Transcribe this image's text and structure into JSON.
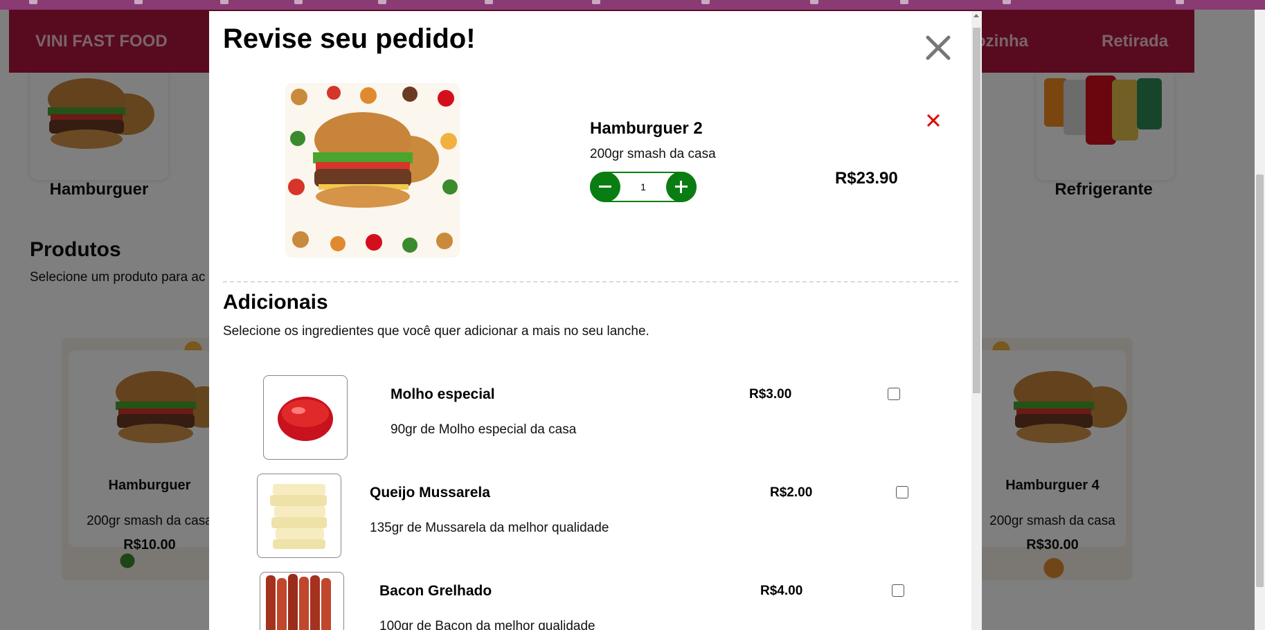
{
  "navbar": {
    "brand": "VINI FAST FOOD",
    "links": [
      "ozinha",
      "Retirada"
    ]
  },
  "categories": [
    {
      "label": "Hamburguer"
    },
    {
      "label": "Refrigerante"
    }
  ],
  "products_section": {
    "title": "Produtos",
    "subtitle": "Selecione um produto para ac"
  },
  "product_cards": [
    {
      "name": "Hamburguer",
      "description": "200gr smash da casa",
      "price": "R$10.00"
    },
    {
      "name": "Hamburguer 4",
      "description": "200gr smash da casa",
      "price": "R$30.00"
    }
  ],
  "modal": {
    "title": "Revise seu pedido!",
    "close_icon": "close-icon",
    "item": {
      "name": "Hamburguer 2",
      "description": "200gr smash da casa",
      "quantity": "1",
      "price": "R$23.90",
      "remove_icon": "remove-icon"
    },
    "additionals": {
      "title": "Adicionais",
      "subtitle": "Selecione os ingredientes que você quer adicionar a mais no seu lanche.",
      "items": [
        {
          "name": "Molho especial",
          "description": "90gr de Molho especial da casa",
          "price": "R$3.00",
          "checked": false
        },
        {
          "name": "Queijo Mussarela",
          "description": "135gr de Mussarela da melhor qualidade",
          "price": "R$2.00",
          "checked": false
        },
        {
          "name": "Bacon Grelhado",
          "description": "100gr de Bacon da melhor qualidade",
          "price": "R$4.00",
          "checked": false
        }
      ]
    }
  },
  "colors": {
    "navbar": "#b1163f",
    "navbar_text": "#f4c7d3",
    "qty_control": "#0a7d12",
    "remove": "#e00000",
    "overlay": "rgba(0,0,0,0.5)"
  }
}
